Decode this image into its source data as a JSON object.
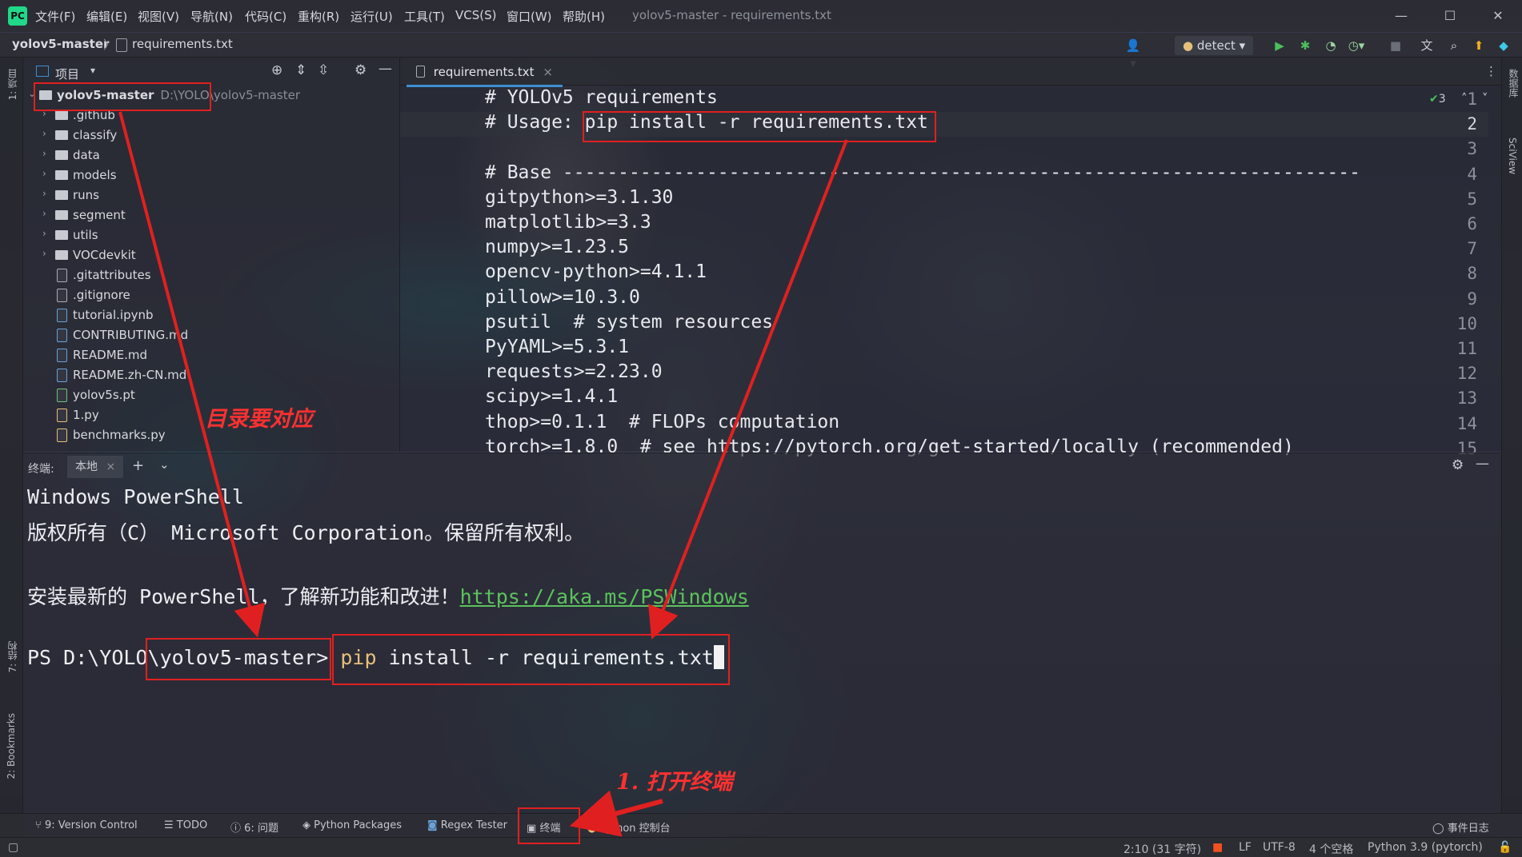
{
  "menu": {
    "items": [
      "文件(F)",
      "编辑(E)",
      "视图(V)",
      "导航(N)",
      "代码(C)",
      "重构(R)",
      "运行(U)",
      "工具(T)",
      "VCS(S)",
      "窗口(W)",
      "帮助(H)"
    ],
    "window_title": "yolov5-master - requirements.txt"
  },
  "nav": {
    "project": "yolov5-master",
    "separator": "〉",
    "file": "requirements.txt",
    "run_config": "detect"
  },
  "left_strip": {
    "project_tab": "1: 项目",
    "structure_tab": "7: 结构",
    "bookmarks_tab": "2: Bookmarks"
  },
  "right_strip": {
    "database_tab": "数据库",
    "sciview_tab": "SciView"
  },
  "project_panel": {
    "title": "项目",
    "root": {
      "name": "yolov5-master",
      "path": "D:\\YOLO\\yolov5-master"
    },
    "folders": [
      ".github",
      "classify",
      "data",
      "models",
      "runs",
      "segment",
      "utils",
      "VOCdevkit"
    ],
    "files": [
      ".gitattributes",
      ".gitignore",
      "tutorial.ipynb",
      "CONTRIBUTING.md",
      "README.md",
      "README.zh-CN.md",
      "yolov5s.pt",
      "1.py",
      "benchmarks.py"
    ]
  },
  "editor": {
    "tab": "requirements.txt",
    "inspection_count": "3",
    "lines": [
      {
        "n": "1",
        "text": "# YOLOv5 requirements"
      },
      {
        "n": "2",
        "text": "# Usage: pip install -r requirements.txt"
      },
      {
        "n": "3",
        "text": ""
      },
      {
        "n": "4",
        "text": "# Base ------------------------------------------------------------------------"
      },
      {
        "n": "5",
        "text": "gitpython>=3.1.30"
      },
      {
        "n": "6",
        "text": "matplotlib>=3.3"
      },
      {
        "n": "7",
        "text": "numpy>=1.23.5"
      },
      {
        "n": "8",
        "text": "opencv-python>=4.1.1"
      },
      {
        "n": "9",
        "text": "pillow>=10.3.0"
      },
      {
        "n": "10",
        "text": "psutil  # system resources"
      },
      {
        "n": "11",
        "text": "PyYAML>=5.3.1"
      },
      {
        "n": "12",
        "text": "requests>=2.23.0"
      },
      {
        "n": "13",
        "text": "scipy>=1.4.1"
      },
      {
        "n": "14",
        "text": "thop>=0.1.1  # FLOPs computation"
      },
      {
        "n": "15",
        "text": "torch>=1.8.0  # see https://pytorch.org/get-started/locally (recommended)"
      }
    ]
  },
  "terminal": {
    "label": "终端:",
    "tab": "本地",
    "line1": "Windows PowerShell",
    "line2": "版权所有（C） Microsoft Corporation。保留所有权利。",
    "line3_prefix": "安装最新的 PowerShell，了解新功能和改进！",
    "line3_link": "https://aka.ms/PSWindows",
    "prompt_drive": "PS D:\\YOLO",
    "prompt_dir": "\\yolov5-master>",
    "cmd_pip": "pip",
    "cmd_rest": " install -r requirements.txt"
  },
  "bottom_tabs": {
    "version_control": "9: Version Control",
    "todo": "TODO",
    "problems": "6: 问题",
    "python_packages": "Python Packages",
    "regex_tester": "Regex Tester",
    "terminal": "终端",
    "python_console": "Python 控制台",
    "event_log": "事件日志"
  },
  "status": {
    "position": "2:10 (31 字符)",
    "line_sep": "LF",
    "encoding": "UTF-8",
    "indent": "4 个空格",
    "interpreter": "Python 3.9 (pytorch)"
  },
  "annotations": {
    "dir_note": "目录要对应",
    "terminal_note": "1. 打开终端"
  },
  "colors": {
    "annotation": "#e02020",
    "link": "#5bc35b",
    "accent": "#3d8fd1"
  }
}
